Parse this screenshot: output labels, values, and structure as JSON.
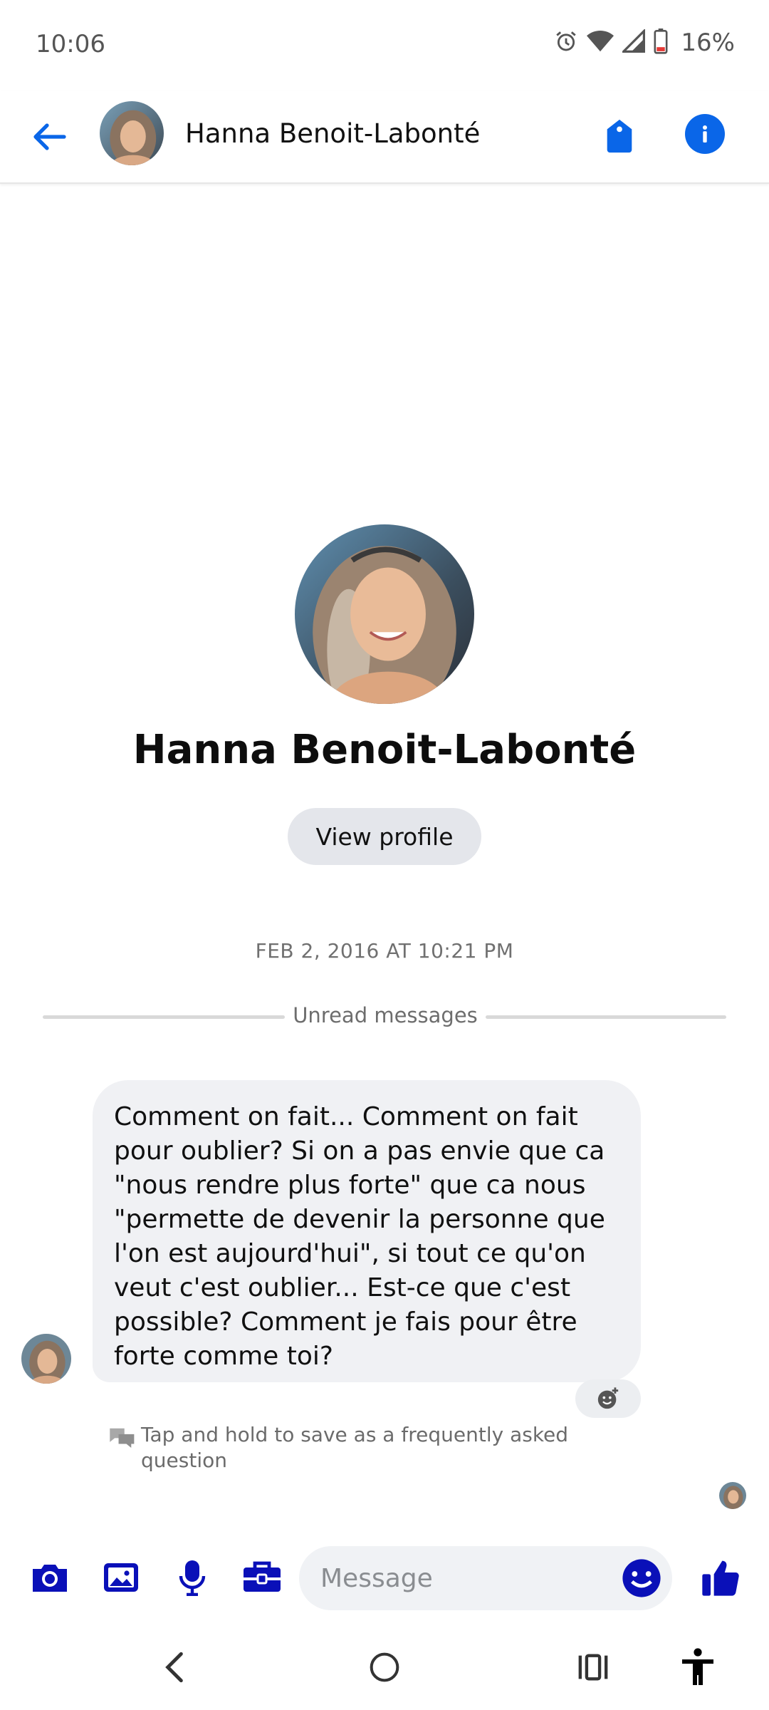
{
  "status_bar": {
    "time": "10:06",
    "battery": "16%",
    "icons": [
      "alarm-icon",
      "wifi-icon",
      "signal-icon",
      "battery-icon"
    ]
  },
  "header": {
    "contact_name": "Hanna Benoit-Labonté",
    "icons": [
      "back-arrow-icon",
      "tag-icon",
      "info-icon"
    ],
    "accent_color": "#0a66e8"
  },
  "profile": {
    "name": "Hanna Benoit-Labonté",
    "view_profile_label": "View profile"
  },
  "conversation": {
    "timestamp": "FEB 2, 2016 AT 10:21 PM",
    "unread_label": "Unread messages",
    "messages": [
      {
        "text": "Comment on fait... Comment on fait pour oublier? Si on a pas envie que ca \"nous rendre plus forte\" que ca nous \"permette de devenir la personne que l'on est aujourd'hui\", si tout ce qu'on veut c'est oublier... Est-ce que c'est possible? Comment je fais pour être forte comme toi?"
      }
    ],
    "faq_hint": "Tap and hold to save as a frequently asked question"
  },
  "composer": {
    "placeholder": "Message",
    "icons": [
      "camera-icon",
      "gallery-icon",
      "microphone-icon",
      "briefcase-icon",
      "emoji-icon",
      "thumbs-up-icon"
    ],
    "icon_color": "#0a10b8"
  },
  "navbar": {
    "icons": [
      "back-nav-icon",
      "home-nav-icon",
      "recents-nav-icon",
      "accessibility-icon"
    ]
  }
}
